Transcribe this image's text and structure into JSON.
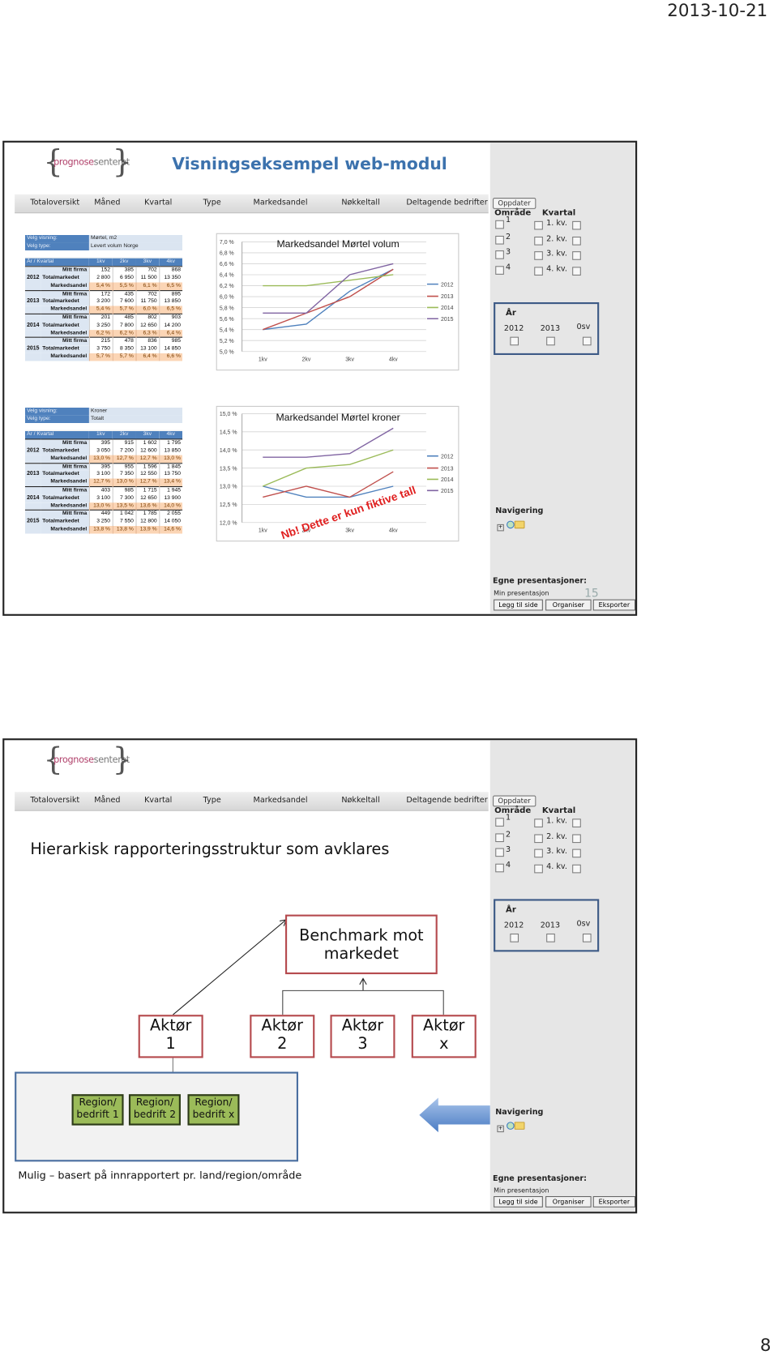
{
  "header_date": "2013-10-21",
  "page_number": "8",
  "nav_items": [
    "Totaloversikt",
    "Måned",
    "Kvartal",
    "Type",
    "Markedsandel",
    "Nøkkeltall",
    "Deltagende bedrifter"
  ],
  "panel": {
    "update_button": "Oppdater",
    "area_label": "Område",
    "quarter_label": "Kvartal",
    "areas": [
      "1",
      "2",
      "3",
      "4"
    ],
    "quarters": [
      "1. kv.",
      "2. kv.",
      "3. kv.",
      "4. kv."
    ],
    "year_label": "År",
    "years": [
      "2012",
      "2013",
      "0sv"
    ],
    "navigation_label": "Navigering",
    "own_presentations_label": "Egne presentasjoner:",
    "my_presentation": "Min presentasjon",
    "buttons": [
      "Legg til side",
      "Organiser",
      "Eksporter"
    ]
  },
  "logo_text": {
    "part1": "prognose",
    "part2": "senteret"
  },
  "slide1": {
    "title": "Visningseksempel web-modul",
    "slide_number": "15",
    "disclaimer": "Nb! Dette er kun fiktive tall",
    "tables": [
      {
        "view_label": "Velg visning:",
        "view_value": "Mørtel, m2",
        "type_label": "Velg type:",
        "type_value": "Levert volum Norge",
        "corner": "År / Kvartal",
        "columns": [
          "1kv",
          "2kv",
          "3kv",
          "4kv"
        ],
        "groups": [
          {
            "year": "2012",
            "rows": [
              [
                "Mitt firma",
                "152",
                "385",
                "702",
                "868"
              ],
              [
                "Totalmarkedet",
                "2 800",
                "6 950",
                "11 500",
                "13 350"
              ],
              [
                "Markedsandel",
                "5,4 %",
                "5,5 %",
                "6,1 %",
                "6,5 %"
              ]
            ]
          },
          {
            "year": "2013",
            "rows": [
              [
                "Mitt firma",
                "172",
                "435",
                "702",
                "895"
              ],
              [
                "Totalmarkedet",
                "3 200",
                "7 600",
                "11 750",
                "13 850"
              ],
              [
                "Markedsandel",
                "5,4 %",
                "5,7 %",
                "6,0 %",
                "6,5 %"
              ]
            ]
          },
          {
            "year": "2014",
            "rows": [
              [
                "Mitt firma",
                "201",
                "485",
                "802",
                "903"
              ],
              [
                "Totalmarkedet",
                "3 250",
                "7 800",
                "12 650",
                "14 200"
              ],
              [
                "Markedsandel",
                "6,2 %",
                "6,2 %",
                "6,3 %",
                "6,4 %"
              ]
            ]
          },
          {
            "year": "2015",
            "rows": [
              [
                "Mitt firma",
                "215",
                "478",
                "836",
                "985"
              ],
              [
                "Totalmarkedet",
                "3 750",
                "8 350",
                "13 100",
                "14 850"
              ],
              [
                "Markedsandel",
                "5,7 %",
                "5,7 %",
                "6,4 %",
                "6,6 %"
              ]
            ]
          }
        ]
      },
      {
        "view_label": "Velg visning:",
        "view_value": "Kroner",
        "type_label": "Velg type:",
        "type_value": "Totalt",
        "corner": "År / Kvartal",
        "columns": [
          "1kv",
          "2kv",
          "3kv",
          "4kv"
        ],
        "groups": [
          {
            "year": "2012",
            "rows": [
              [
                "Mitt firma",
                "395",
                "915",
                "1 602",
                "1 795"
              ],
              [
                "Totalmarkedet",
                "3 050",
                "7 200",
                "12 600",
                "13 850"
              ],
              [
                "Markedsandel",
                "13,0 %",
                "12,7 %",
                "12,7 %",
                "13,0 %"
              ]
            ]
          },
          {
            "year": "2013",
            "rows": [
              [
                "Mitt firma",
                "395",
                "955",
                "1 596",
                "1 845"
              ],
              [
                "Totalmarkedet",
                "3 100",
                "7 350",
                "12 550",
                "13 750"
              ],
              [
                "Markedsandel",
                "12,7 %",
                "13,0 %",
                "12,7 %",
                "13,4 %"
              ]
            ]
          },
          {
            "year": "2014",
            "rows": [
              [
                "Mitt firma",
                "403",
                "985",
                "1 715",
                "1 945"
              ],
              [
                "Totalmarkedet",
                "3 100",
                "7 300",
                "12 650",
                "13 900"
              ],
              [
                "Markedsandel",
                "13,0 %",
                "13,5 %",
                "13,6 %",
                "14,0 %"
              ]
            ]
          },
          {
            "year": "2015",
            "rows": [
              [
                "Mitt firma",
                "449",
                "1 042",
                "1 785",
                "2 055"
              ],
              [
                "Totalmarkedet",
                "3 250",
                "7 550",
                "12 800",
                "14 050"
              ],
              [
                "Markedsandel",
                "13,8 %",
                "13,8 %",
                "13,9 %",
                "14,6 %"
              ]
            ]
          }
        ]
      }
    ]
  },
  "chart_data": [
    {
      "type": "line",
      "title": "Markedsandel Mørtel volum",
      "categories": [
        "1kv",
        "2kv",
        "3kv",
        "4kv"
      ],
      "ylim": [
        5.0,
        7.0
      ],
      "yticks": [
        "5,0 %",
        "5,2 %",
        "5,4 %",
        "5,6 %",
        "5,8 %",
        "6,0 %",
        "6,2 %",
        "6,4 %",
        "6,6 %",
        "6,8 %",
        "7,0 %"
      ],
      "grid": true,
      "legend": "right",
      "series": [
        {
          "name": "2012",
          "color": "#4f81bd",
          "values": [
            5.4,
            5.5,
            6.1,
            6.5
          ]
        },
        {
          "name": "2013",
          "color": "#c0504d",
          "values": [
            5.4,
            5.7,
            6.0,
            6.5
          ]
        },
        {
          "name": "2014",
          "color": "#9bbb59",
          "values": [
            6.2,
            6.2,
            6.3,
            6.4
          ]
        },
        {
          "name": "2015",
          "color": "#8064a2",
          "values": [
            5.7,
            5.7,
            6.4,
            6.6
          ]
        }
      ]
    },
    {
      "type": "line",
      "title": "Markedsandel Mørtel kroner",
      "categories": [
        "1kv",
        "2kv",
        "3kv",
        "4kv"
      ],
      "ylim": [
        12.0,
        15.0
      ],
      "yticks": [
        "12,0 %",
        "12,5 %",
        "13,0 %",
        "13,5 %",
        "14,0 %",
        "14,5 %",
        "15,0 %"
      ],
      "grid": true,
      "legend": "right",
      "series": [
        {
          "name": "2012",
          "color": "#4f81bd",
          "values": [
            13.0,
            12.7,
            12.7,
            13.0
          ]
        },
        {
          "name": "2013",
          "color": "#c0504d",
          "values": [
            12.7,
            13.0,
            12.7,
            13.4
          ]
        },
        {
          "name": "2014",
          "color": "#9bbb59",
          "values": [
            13.0,
            13.5,
            13.6,
            14.0
          ]
        },
        {
          "name": "2015",
          "color": "#8064a2",
          "values": [
            13.8,
            13.8,
            13.9,
            14.6
          ]
        }
      ]
    }
  ],
  "slide2": {
    "title": "Hierarkisk rapporteringsstruktur som avklares",
    "benchmark": [
      "Benchmark mot",
      "markedet"
    ],
    "actors": [
      [
        "Aktør",
        "1"
      ],
      [
        "Aktør",
        "2"
      ],
      [
        "Aktør",
        "3"
      ],
      [
        "Aktør",
        "x"
      ]
    ],
    "regions": [
      [
        "Region/",
        "bedrift 1"
      ],
      [
        "Region/",
        "bedrift 2"
      ],
      [
        "Region/",
        "bedrift x"
      ]
    ],
    "footnote": "Mulig – basert på innrapportert pr. land/region/område"
  },
  "colors": {
    "title_blue": "#3c72ad",
    "box_red": "#b54a4e",
    "region_green": "#9bbb59",
    "panel_gray": "#e6e6e6"
  }
}
